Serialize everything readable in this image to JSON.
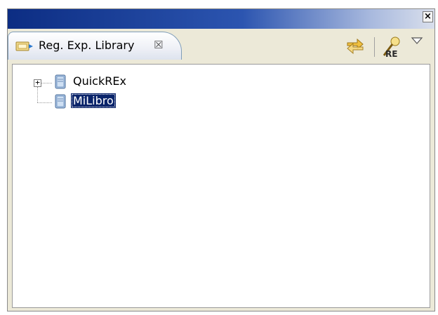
{
  "window": {
    "close_glyph": "×"
  },
  "view": {
    "tab": {
      "label": "Reg. Exp. Library",
      "close_glyph": "☒",
      "icon": "library-icon"
    },
    "toolbar": {
      "items": [
        {
          "icon": "link-with-editor-icon"
        },
        {
          "icon": "regex-icon",
          "icon_text": "RE"
        },
        {
          "icon": "view-menu-icon"
        }
      ]
    }
  },
  "tree": {
    "nodes": [
      {
        "label": "QuickREx",
        "expandable": true,
        "expander_glyph": "+",
        "icon": "book-icon",
        "selected": false
      },
      {
        "label": "MiLibro",
        "expandable": false,
        "icon": "book-icon",
        "selected": true
      }
    ]
  },
  "colors": {
    "titlebar_start": "#0c2d83",
    "selection": "#0a246a",
    "tab_border": "#7f9db9"
  }
}
